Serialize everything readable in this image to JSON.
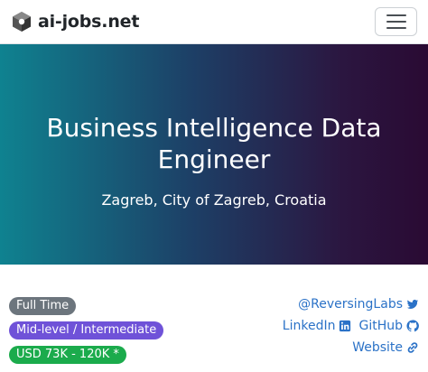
{
  "header": {
    "brand": "ai-jobs.net",
    "logo_icon": "cube-logo-icon",
    "menu_icon": "hamburger-menu-icon"
  },
  "hero": {
    "title": "Business Intelligence Data Engineer",
    "location": "Zagreb, City of Zagreb, Croatia"
  },
  "badges": {
    "employment_type": "Full Time",
    "level": "Mid-level / Intermediate",
    "salary": "USD 73K - 120K *"
  },
  "company_links": {
    "twitter": "@ReversingLabs",
    "linkedin": "LinkedIn",
    "github": "GitHub",
    "website": "Website"
  },
  "colors": {
    "badge_gray": "#6c757d",
    "badge_purple": "#6f52d8",
    "badge_green": "#1bab4c",
    "link": "#2b72c7"
  }
}
